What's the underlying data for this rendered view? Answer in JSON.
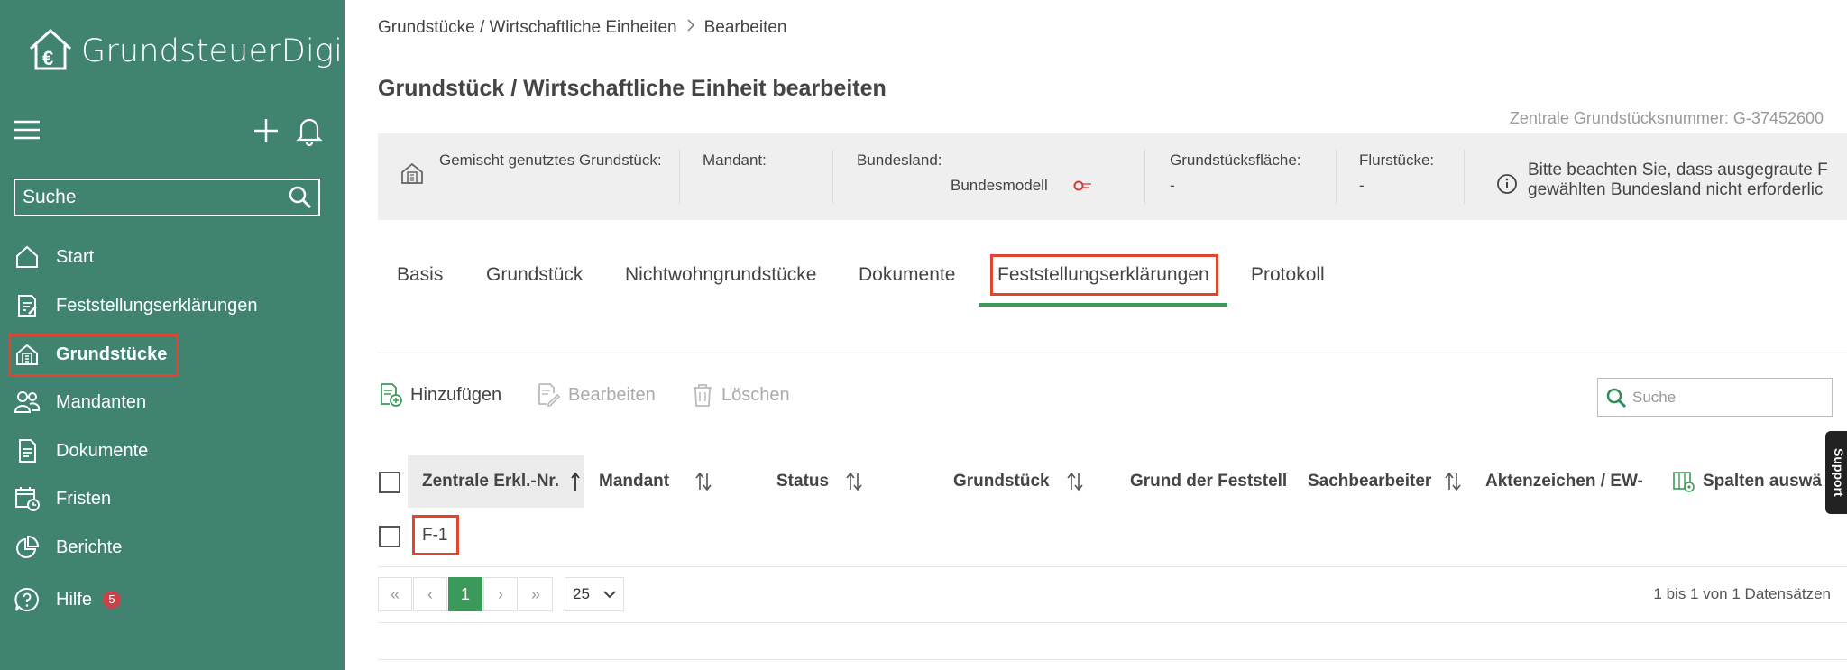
{
  "sidebar": {
    "logo_text": "GrundsteuerDigital",
    "search_placeholder": "Suche",
    "items": [
      {
        "label": "Start",
        "icon": "home-icon"
      },
      {
        "label": "Feststellungserklärungen",
        "icon": "document-edit-icon"
      },
      {
        "label": "Grundstücke",
        "icon": "building-icon",
        "active": true
      },
      {
        "label": "Mandanten",
        "icon": "users-icon"
      },
      {
        "label": "Dokumente",
        "icon": "document-icon"
      },
      {
        "label": "Fristen",
        "icon": "calendar-icon"
      },
      {
        "label": "Berichte",
        "icon": "pie-chart-icon"
      },
      {
        "label": "Hilfe",
        "icon": "help-icon",
        "badge": "5"
      }
    ]
  },
  "breadcrumb": {
    "parent": "Grundstücke / Wirtschaftliche Einheiten",
    "current": "Bearbeiten"
  },
  "page_title": "Grundstück / Wirtschaftliche Einheit bearbeiten",
  "zentrale_nummer": "Zentrale Grundstücksnummer: G-37452600",
  "info_bar": {
    "type_label": "Gemischt genutztes Grundstück:",
    "mandant_label": "Mandant:",
    "bundesland_label": "Bundesland:",
    "bundesland_value": "Bundesmodell",
    "flaeche_label": "Grundstücksfläche:",
    "flaeche_value": "-",
    "flurstuecke_label": "Flurstücke:",
    "flurstuecke_value": "-",
    "notice_line1": "Bitte beachten Sie, dass ausgegraute F",
    "notice_line2": "gewählten Bundesland nicht erforderlic"
  },
  "tabs": [
    "Basis",
    "Grundstück",
    "Nichtwohngrundstücke",
    "Dokumente",
    "Feststellungserklärungen",
    "Protokoll"
  ],
  "active_tab": "Feststellungserklärungen",
  "toolbar": {
    "add": "Hinzufügen",
    "edit": "Bearbeiten",
    "delete": "Löschen",
    "search_placeholder": "Suche"
  },
  "table": {
    "columns": [
      "Zentrale Erkl.-Nr.",
      "Mandant",
      "Status",
      "Grundstück",
      "Grund der Feststell",
      "Sachbearbeiter",
      "Aktenzeichen / EW-"
    ],
    "columns_button": "Spalten auswä",
    "rows": [
      {
        "nr": "F-1"
      }
    ]
  },
  "pagination": {
    "first": "«",
    "prev": "‹",
    "current_page": "1",
    "next": "›",
    "last": "»",
    "page_size": "25",
    "summary": "1 bis 1 von 1 Datensätzen"
  },
  "support_label": "Support",
  "colors": {
    "sidebar_bg": "#3f8370",
    "accent_green": "#3b9a5a",
    "highlight_red": "#e0452f"
  }
}
